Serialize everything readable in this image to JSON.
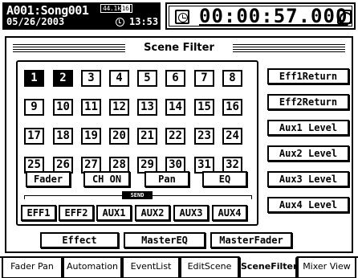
{
  "header": {
    "song_title": "A001:Song001",
    "song_date": "05/26/2003",
    "sample_rate_prefix": "44.1k",
    "sample_rate_bits": "16",
    "clock_time": "13:53",
    "counter": "00:00:57.000"
  },
  "panel": {
    "title": "Scene Filter"
  },
  "channels": [
    "1",
    "2",
    "3",
    "4",
    "5",
    "6",
    "7",
    "8",
    "9",
    "10",
    "11",
    "12",
    "13",
    "14",
    "15",
    "16",
    "17",
    "18",
    "19",
    "20",
    "21",
    "22",
    "23",
    "24",
    "25",
    "26",
    "27",
    "28",
    "29",
    "30",
    "31",
    "32"
  ],
  "channel_states": {
    "1": true,
    "2": true
  },
  "params": [
    "Fader",
    "CH ON",
    "Pan",
    "EQ"
  ],
  "send_label": "SEND",
  "sends": [
    "EFF1",
    "EFF2",
    "AUX1",
    "AUX2",
    "AUX3",
    "AUX4"
  ],
  "returns": [
    "Eff1Return",
    "Eff2Return",
    "Aux1 Level",
    "Aux2 Level",
    "Aux3 Level",
    "Aux4 Level"
  ],
  "bottom_buttons": [
    "Effect",
    "MasterEQ",
    "MasterFader"
  ],
  "tabs": [
    "Fader Pan",
    "Automation",
    "EventList",
    "EditScene",
    "SceneFilter",
    "Mixer View"
  ],
  "active_tab": "SceneFilter",
  "icons": {
    "clock": "clock-icon",
    "timer": "timer-icon",
    "alarm": "alarm-icon"
  }
}
